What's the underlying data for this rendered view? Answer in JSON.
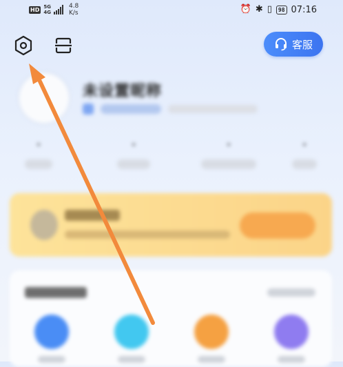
{
  "status_bar": {
    "hd": "HD",
    "network": "5G",
    "network_sub": "4G",
    "speed_value": "4.8",
    "speed_unit": "K/s",
    "battery": "98",
    "time": "07:16"
  },
  "toolbar": {
    "settings_icon": "hexagon-settings-icon",
    "scan_icon": "scan-icon",
    "service_icon": "headset-icon",
    "service_label": "客服"
  },
  "profile": {
    "nickname": "未设置昵称"
  },
  "annotation": {
    "arrow_color": "#f28a3c"
  },
  "colors": {
    "accent": "#3c74f0",
    "vip_card": "#fbd488",
    "order_icons": [
      "#4a8df5",
      "#42c8f0",
      "#f5a142",
      "#8f7cf0"
    ]
  }
}
